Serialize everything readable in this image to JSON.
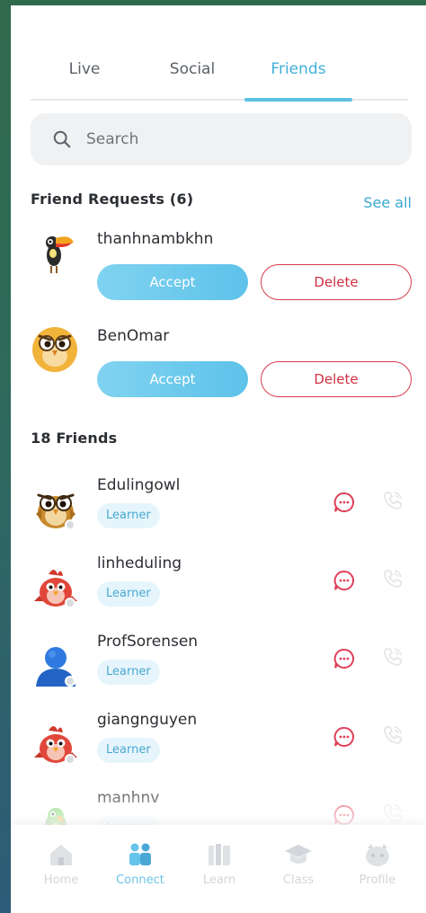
{
  "tabs": [
    {
      "label": "Live"
    },
    {
      "label": "Social"
    },
    {
      "label": "Friends"
    }
  ],
  "active_tab": "Friends",
  "search": {
    "placeholder": "Search",
    "value": ""
  },
  "requests": {
    "title": "Friend Requests (6)",
    "see_all": "See all",
    "items": [
      {
        "name": "thanhnambkhn",
        "avatar": "toucan-avatar",
        "accept": "Accept",
        "delete": "Delete"
      },
      {
        "name": "BenOmar",
        "avatar": "owl-avatar",
        "accept": "Accept",
        "delete": "Delete"
      }
    ]
  },
  "friends": {
    "title": "18 Friends",
    "items": [
      {
        "name": "Edulingowl",
        "badge": "Learner",
        "avatar": "owl-avatar"
      },
      {
        "name": "linheduling",
        "badge": "Learner",
        "avatar": "red-bird-avatar"
      },
      {
        "name": "ProfSorensen",
        "badge": "Learner",
        "avatar": "default-user-avatar"
      },
      {
        "name": "giangnguyen",
        "badge": "Learner",
        "avatar": "red-bird-avatar"
      },
      {
        "name": "manhnv",
        "badge": "Learner",
        "avatar": "green-parrot-avatar"
      }
    ]
  },
  "nav": [
    {
      "label": "Home",
      "icon": "home-icon"
    },
    {
      "label": "Connect",
      "icon": "people-icon"
    },
    {
      "label": "Learn",
      "icon": "books-icon"
    },
    {
      "label": "Class",
      "icon": "graduation-cap-icon"
    },
    {
      "label": "Profile",
      "icon": "profile-face-icon"
    }
  ],
  "active_nav": "Connect",
  "colors": {
    "accent": "#42b0d8",
    "delete": "#d83a4c",
    "chat_icon": "#e0415a",
    "badge_bg": "#e6f5fc"
  }
}
